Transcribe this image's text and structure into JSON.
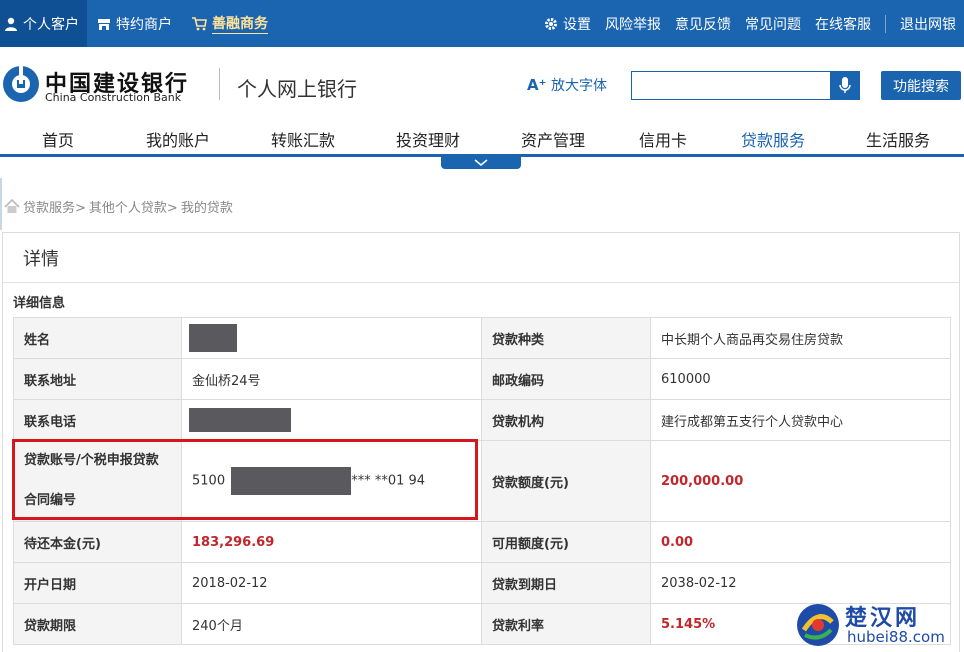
{
  "topbar": {
    "personal": "个人客户",
    "merchant": "特约商户",
    "shanrong": "善融商务",
    "settings": "设置",
    "report": "风险举报",
    "feedback": "意见反馈",
    "faq": "常见问题",
    "service": "在线客服",
    "logout": "退出网银"
  },
  "header": {
    "bank_cn": "中国建设银行",
    "bank_en": "China Construction Bank",
    "subtitle": "个人网上银行",
    "enlarge_font": "放大字体",
    "search_placeholder": "",
    "function_search": "功能搜索"
  },
  "nav": [
    "首页",
    "我的账户",
    "转账汇款",
    "投资理财",
    "资产管理",
    "信用卡",
    "贷款服务",
    "生活服务"
  ],
  "breadcrumb": [
    "贷款服务>",
    "其他个人贷款>",
    "我的贷款"
  ],
  "panel": {
    "title": "详情",
    "subtitle": "详细信息"
  },
  "rows": [
    {
      "l1": "姓名",
      "v1": "",
      "l2": "贷款种类",
      "v2": "中长期个人商品再交易住房贷款"
    },
    {
      "l1": "联系地址",
      "v1": "金仙桥24号",
      "l2": "邮政编码",
      "v2": "610000"
    },
    {
      "l1": "联系电话",
      "v1": "",
      "l2": "贷款机构",
      "v2": "建行成都第五支行个人贷款中心"
    },
    {
      "l1": "贷款账号/个税申报贷款合同编号",
      "v1_prefix": "5100",
      "v1_suffix": "*** **01 94",
      "l2": "贷款额度(元)",
      "v2": "200,000.00"
    },
    {
      "l1": "待还本金(元)",
      "v1": "183,296.69",
      "l2": "可用额度(元)",
      "v2": "0.00"
    },
    {
      "l1": "开户日期",
      "v1": "2018-02-12",
      "l2": "贷款到期日",
      "v2": "2038-02-12"
    },
    {
      "l1": "贷款期限",
      "v1": "240个月",
      "l2": "贷款利率",
      "v2": "5.145%"
    }
  ],
  "watermark": {
    "cn": "楚汉网",
    "en": "hubei88.com"
  },
  "colors": {
    "brand_blue": "#1a64b0",
    "highlight_red": "#d6161c",
    "value_red": "#c0262c"
  }
}
